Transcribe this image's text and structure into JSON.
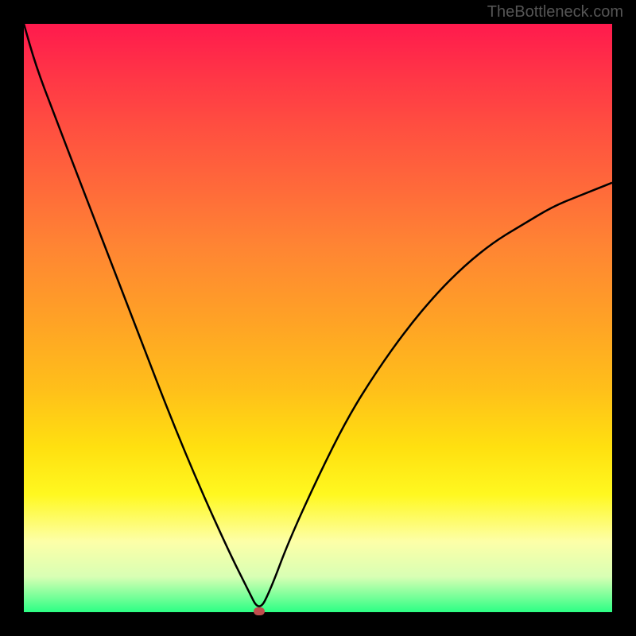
{
  "watermark": "TheBottleneck.com",
  "chart_data": {
    "type": "line",
    "title": "",
    "xlabel": "",
    "ylabel": "",
    "x": [
      0,
      2,
      5,
      10,
      15,
      20,
      25,
      30,
      35,
      38,
      40,
      42,
      45,
      50,
      55,
      60,
      65,
      70,
      75,
      80,
      85,
      90,
      95,
      100
    ],
    "values": [
      100,
      93,
      85,
      72,
      59,
      46,
      33,
      21,
      10,
      4,
      0,
      4,
      12,
      23,
      33,
      41,
      48,
      54,
      59,
      63,
      66,
      69,
      71,
      73
    ],
    "ylim": [
      0,
      100
    ],
    "xlim": [
      0,
      100
    ],
    "minimum_point": {
      "x": 40,
      "y": 0
    },
    "background": "rainbow-gradient (red top, green bottom)",
    "note": "V-shaped bottleneck curve; x/y units are percentage (visible ticks absent, values estimated from pixel position)"
  },
  "colors": {
    "frame": "#000000",
    "curve": "#000000",
    "dot": "#c14d4d",
    "gradient_top": "#ff1a4d",
    "gradient_bottom": "#2cff84"
  }
}
